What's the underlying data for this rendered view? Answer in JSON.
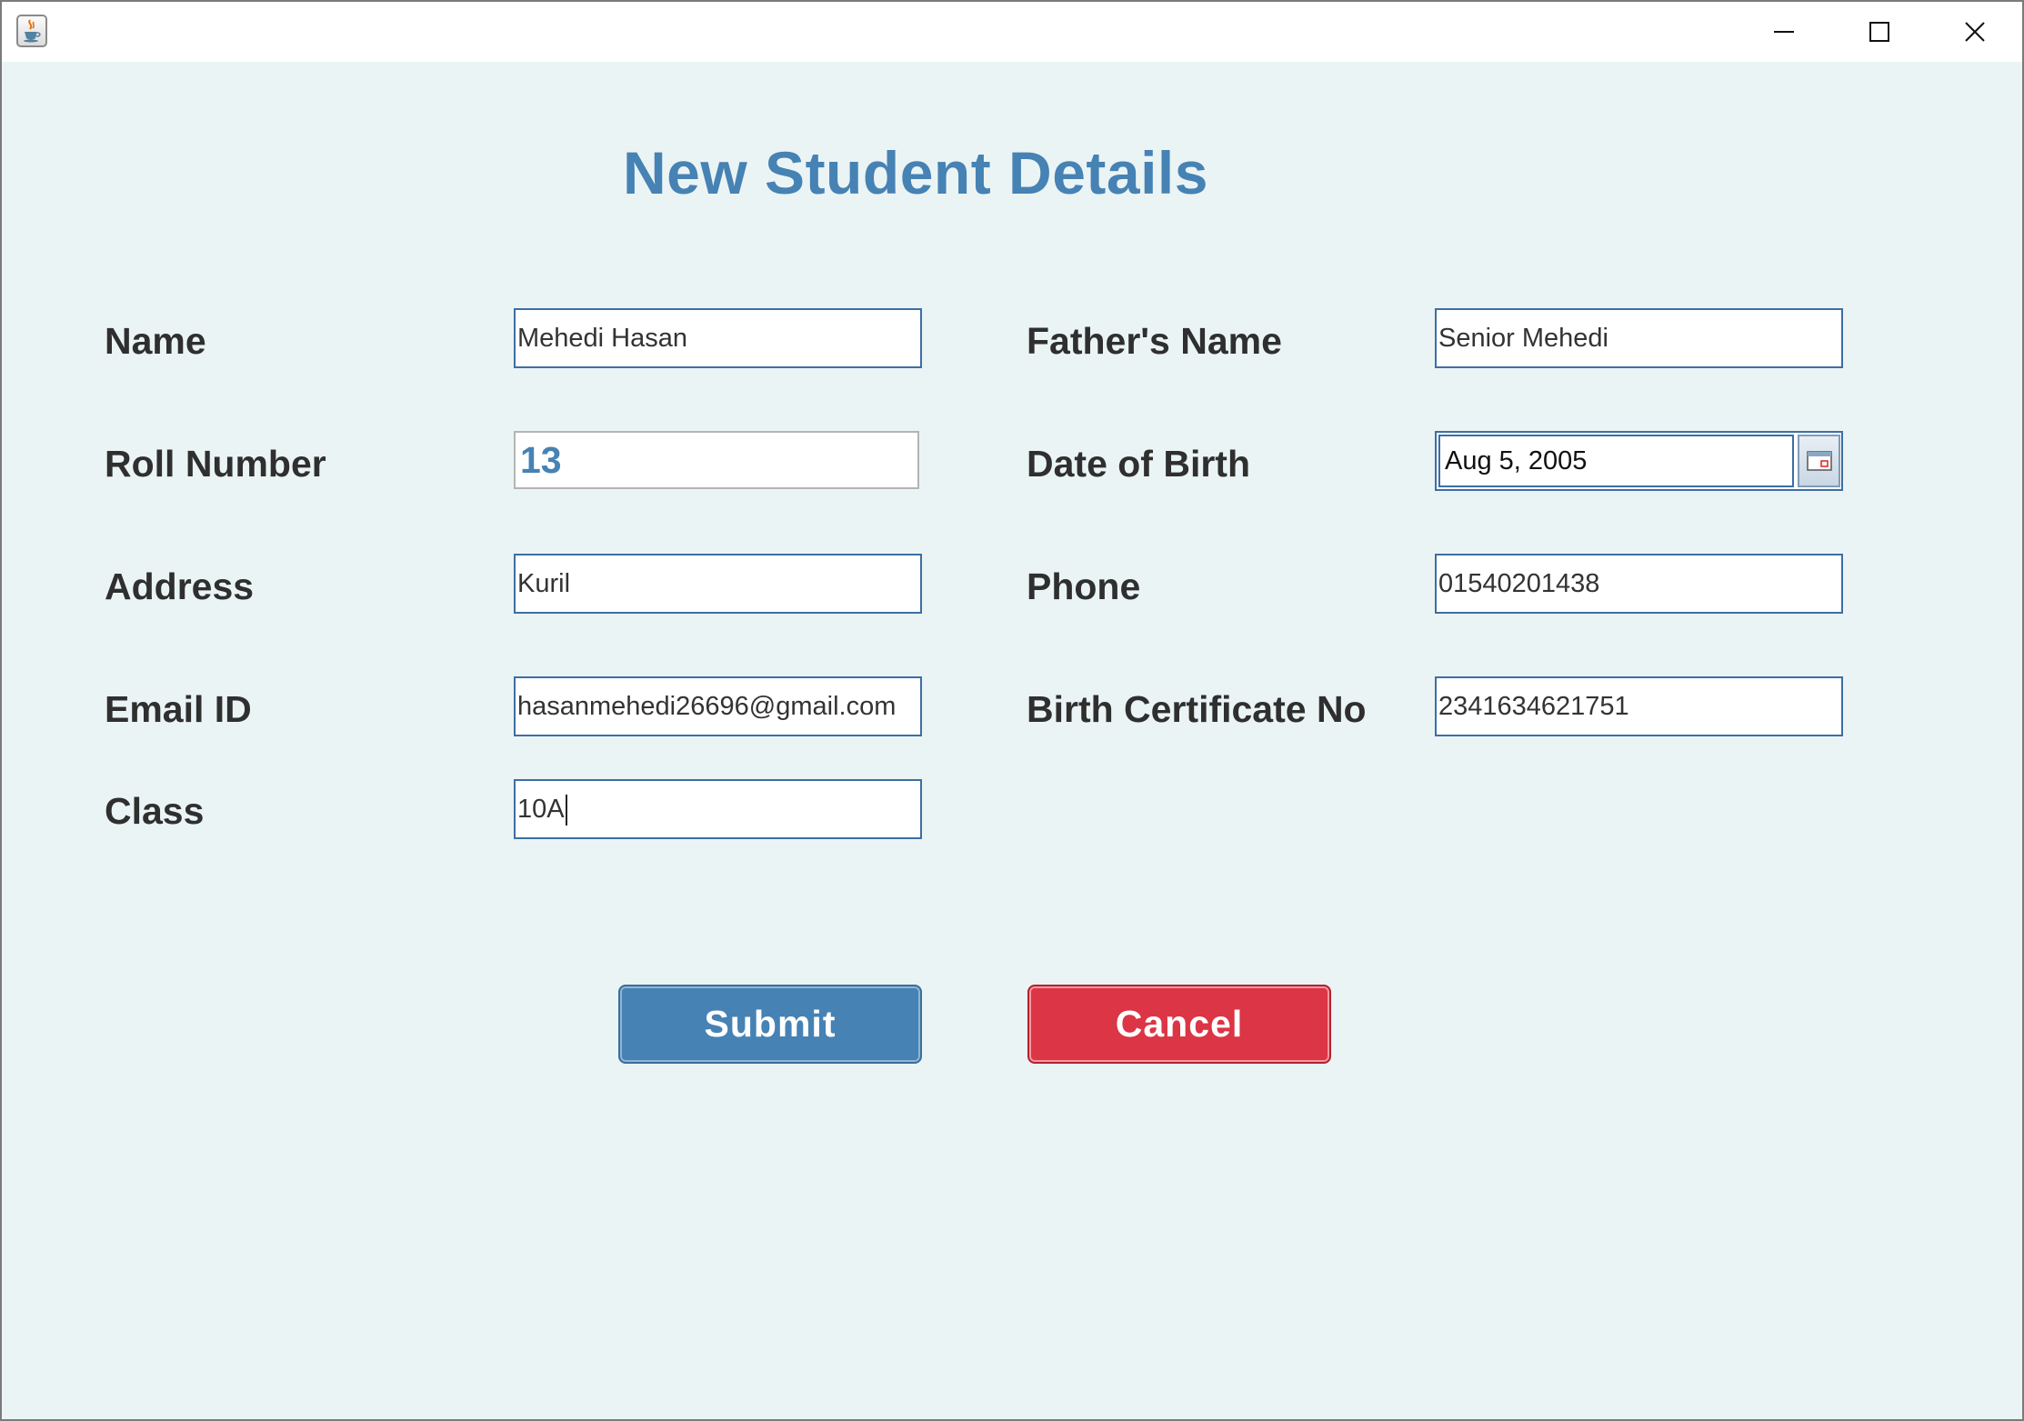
{
  "window": {
    "title": "",
    "icon": "java-coffee-icon",
    "controls": [
      "minimize-icon",
      "maximize-icon",
      "close-icon"
    ]
  },
  "form": {
    "title": "New Student Details",
    "fields": {
      "name": {
        "label": "Name",
        "value": "Mehedi Hasan"
      },
      "fathers_name": {
        "label": "Father's Name",
        "value": "Senior Mehedi"
      },
      "roll_number": {
        "label": "Roll Number",
        "value": "13"
      },
      "date_of_birth": {
        "label": "Date of Birth",
        "value": "Aug 5, 2005"
      },
      "address": {
        "label": "Address",
        "value": "Kuril"
      },
      "phone": {
        "label": "Phone",
        "value": "01540201438"
      },
      "email": {
        "label": "Email ID",
        "value": "hasanmehedi26696@gmail.com"
      },
      "birth_certificate": {
        "label": "Birth Certificate No",
        "value": "2341634621751"
      },
      "class": {
        "label": "Class",
        "value": "10A"
      }
    }
  },
  "actions": {
    "submit_label": "Submit",
    "cancel_label": "Cancel"
  },
  "colors": {
    "background": "#ebf4f4",
    "title": "#4682b4",
    "submit": "#4682b4",
    "cancel": "#dc3545",
    "field_border": "#3d6ea5"
  }
}
